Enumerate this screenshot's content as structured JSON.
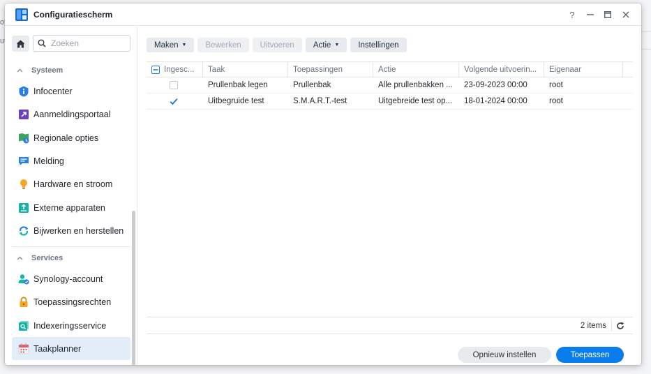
{
  "background": {
    "fragments": [
      "of",
      "ut"
    ]
  },
  "window": {
    "title": "Configuratiescherm",
    "help_glyph": "?",
    "minimize_glyph": "—",
    "close_glyph": "✕"
  },
  "sidebar": {
    "search_placeholder": "Zoeken",
    "sections": [
      {
        "title": "Systeem",
        "items": [
          {
            "label": "Infocenter",
            "icon": "info-icon"
          },
          {
            "label": "Aanmeldingsportaal",
            "icon": "login-portal-icon"
          },
          {
            "label": "Regionale opties",
            "icon": "regional-options-icon"
          },
          {
            "label": "Melding",
            "icon": "notification-icon"
          },
          {
            "label": "Hardware en stroom",
            "icon": "lightbulb-icon"
          },
          {
            "label": "Externe apparaten",
            "icon": "external-device-icon"
          },
          {
            "label": "Bijwerken en herstellen",
            "icon": "update-restore-icon"
          }
        ]
      },
      {
        "title": "Services",
        "items": [
          {
            "label": "Synology-account",
            "icon": "account-icon"
          },
          {
            "label": "Toepassingsrechten",
            "icon": "lock-icon"
          },
          {
            "label": "Indexeringsservice",
            "icon": "indexing-icon"
          },
          {
            "label": "Taakplanner",
            "icon": "calendar-icon",
            "active": true
          }
        ]
      }
    ]
  },
  "toolbar": {
    "create": "Maken",
    "edit": "Bewerken",
    "run": "Uitvoeren",
    "action": "Actie",
    "settings": "Instellingen"
  },
  "grid": {
    "columns": [
      "Ingesc...",
      "Taak",
      "Toepassingen",
      "Actie",
      "Volgende uitvoerin...",
      "Eigenaar"
    ],
    "rows": [
      {
        "enabled": false,
        "task": "Prullenbak legen",
        "app": "Prullenbak",
        "action": "Alle prullenbakken ...",
        "next_run": "23-09-2023 00:00",
        "owner": "root"
      },
      {
        "enabled": true,
        "task": "Uitbegruide test",
        "app": "S.M.A.R.T.-test",
        "action": "Uitgebreide test op...",
        "next_run": "18-01-2024 00:00",
        "owner": "root"
      }
    ],
    "items_count": "2 items"
  },
  "footer": {
    "reset": "Opnieuw instellen",
    "apply": "Toepassen"
  },
  "colors": {
    "accent": "#0a7ded",
    "active_bg": "#e3edfa"
  }
}
